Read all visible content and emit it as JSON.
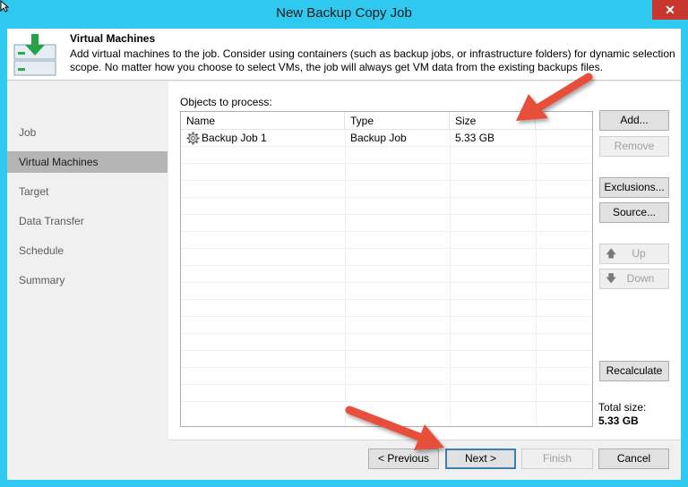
{
  "window": {
    "title": "New Backup Copy Job",
    "close_glyph": "✕"
  },
  "header": {
    "title": "Virtual Machines",
    "description": "Add virtual machines to the job. Consider using containers (such as backup jobs, or infrastructure folders) for dynamic selection scope. No matter how you choose to select VMs, the job will always get VM data from the existing backups files."
  },
  "steps": [
    {
      "label": "Job",
      "active": false
    },
    {
      "label": "Virtual Machines",
      "active": true
    },
    {
      "label": "Target",
      "active": false
    },
    {
      "label": "Data Transfer",
      "active": false
    },
    {
      "label": "Schedule",
      "active": false
    },
    {
      "label": "Summary",
      "active": false
    }
  ],
  "objects": {
    "label": "Objects to process:",
    "columns": [
      "Name",
      "Type",
      "Size"
    ],
    "rows": [
      {
        "name": "Backup Job 1",
        "type": "Backup Job",
        "size": "5.33 GB",
        "icon": "gear-icon"
      }
    ]
  },
  "side_buttons": {
    "add": "Add...",
    "remove": "Remove",
    "exclusions": "Exclusions...",
    "source": "Source...",
    "up": "Up",
    "down": "Down",
    "recalculate": "Recalculate"
  },
  "total": {
    "label": "Total size:",
    "value": "5.33 GB"
  },
  "footer": {
    "previous": "< Previous",
    "next": "Next >",
    "finish": "Finish",
    "cancel": "Cancel"
  },
  "colors": {
    "title_bar": "#2fc9ef",
    "close_button": "#c7372f",
    "annotation_arrow": "#e8503b",
    "selected_step": "#b5b5b5"
  }
}
